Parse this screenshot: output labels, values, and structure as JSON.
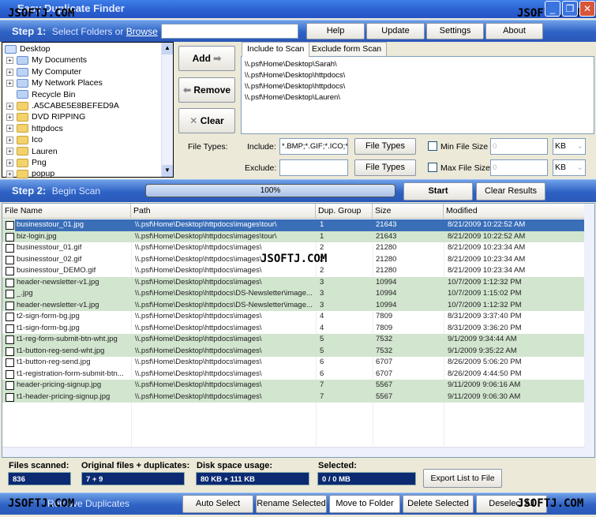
{
  "app": {
    "title": "Easy Duplicate Finder",
    "watermark": "JSOFTJ.COM"
  },
  "window_controls": {
    "minimize": "_",
    "maximize": "❐",
    "close": "✕"
  },
  "step1": {
    "step": "Step 1:",
    "text": "Select Folders or",
    "link": "Browse",
    "input_value": "",
    "buttons": [
      "Help",
      "Update",
      "Settings",
      "About"
    ]
  },
  "tree": {
    "root": "Desktop",
    "items": [
      "My Documents",
      "My Computer",
      "My Network Places",
      "Recycle Bin",
      ".A5CABE5E8BEFED9A",
      "DVD RIPPING",
      "httpdocs",
      "Ico",
      "Lauren",
      "Png",
      "popup"
    ]
  },
  "actions": {
    "add": "Add",
    "remove": "Remove",
    "clear": "Clear"
  },
  "scan_tabs": [
    "Include to Scan",
    "Exclude form Scan"
  ],
  "scan_paths": [
    "\\\\.psf\\Home\\Desktop\\Sarah\\",
    "\\\\.psf\\Home\\Desktop\\httpdocs\\",
    "\\\\.psf\\Home\\Desktop\\httpdocs\\",
    "\\\\.psf\\Home\\Desktop\\Lauren\\"
  ],
  "filters": {
    "file_types_label": "File Types:",
    "include_label": "Include:",
    "include_value": "*.BMP;*.GIF;*.ICO;*.",
    "exclude_label": "Exclude:",
    "exclude_value": "",
    "file_types_btn": "File Types",
    "min_label": "Min File Size",
    "max_label": "Max File Size",
    "min_value": "0",
    "max_value": "0",
    "unit": "KB",
    "min_checked": false,
    "max_checked": false
  },
  "step2": {
    "step": "Step 2:",
    "text": "Begin Scan",
    "progress_text": "100%",
    "progress": 100,
    "start": "Start",
    "clear_results": "Clear Results"
  },
  "table": {
    "columns": [
      "File Name",
      "Path",
      "Dup. Group",
      "Size",
      "Modified"
    ],
    "sort_indicator": "▲",
    "rows": [
      [
        "businesstour_01.jpg",
        "\\\\.psf\\Home\\Desktop\\httpdocs\\images\\tour\\",
        "1",
        "21643",
        "8/21/2009 10:22:52 AM"
      ],
      [
        "biz-login.jpg",
        "\\\\.psf\\Home\\Desktop\\httpdocs\\images\\tour\\",
        "1",
        "21643",
        "8/21/2009 10:22:52 AM"
      ],
      [
        "businesstour_01.gif",
        "\\\\.psf\\Home\\Desktop\\httpdocs\\images\\",
        "2",
        "21280",
        "8/21/2009 10:23:34 AM"
      ],
      [
        "businesstour_02.gif",
        "\\\\.psf\\Home\\Desktop\\httpdocs\\images\\",
        "2",
        "21280",
        "8/21/2009 10:23:34 AM"
      ],
      [
        "businesstour_DEMO.gif",
        "\\\\.psf\\Home\\Desktop\\httpdocs\\images\\",
        "2",
        "21280",
        "8/21/2009 10:23:34 AM"
      ],
      [
        "header-newsletter-v1.jpg",
        "\\\\.psf\\Home\\Desktop\\httpdocs\\images\\",
        "3",
        "10994",
        "10/7/2009 1:12:32 PM"
      ],
      [
        "_.jpg",
        "\\\\.psf\\Home\\Desktop\\httpdocs\\DS-Newsletter\\image...",
        "3",
        "10994",
        "10/7/2009 1:15:02 PM"
      ],
      [
        "header-newsletter-v1.jpg",
        "\\\\.psf\\Home\\Desktop\\httpdocs\\DS-Newsletter\\image...",
        "3",
        "10994",
        "10/7/2009 1:12:32 PM"
      ],
      [
        "t2-sign-form-bg.jpg",
        "\\\\.psf\\Home\\Desktop\\httpdocs\\images\\",
        "4",
        "7809",
        "8/31/2009 3:37:40 PM"
      ],
      [
        "t1-sign-form-bg.jpg",
        "\\\\.psf\\Home\\Desktop\\httpdocs\\images\\",
        "4",
        "7809",
        "8/31/2009 3:36:20 PM"
      ],
      [
        "t1-reg-form-submit-btn-wht.jpg",
        "\\\\.psf\\Home\\Desktop\\httpdocs\\images\\",
        "5",
        "7532",
        "9/1/2009 9:34:44 AM"
      ],
      [
        "t1-button-reg-send-wht.jpg",
        "\\\\.psf\\Home\\Desktop\\httpdocs\\images\\",
        "5",
        "7532",
        "9/1/2009 9:35:22 AM"
      ],
      [
        "t1-button-reg-send.jpg",
        "\\\\.psf\\Home\\Desktop\\httpdocs\\images\\",
        "6",
        "6707",
        "8/26/2009 5:06:20 PM"
      ],
      [
        "t1-registration-form-submit-btn...",
        "\\\\.psf\\Home\\Desktop\\httpdocs\\images\\",
        "6",
        "6707",
        "8/26/2009 4:44:50 PM"
      ],
      [
        "header-pricing-signup.jpg",
        "\\\\.psf\\Home\\Desktop\\httpdocs\\images\\",
        "7",
        "5567",
        "9/11/2009 9:06:16 AM"
      ],
      [
        "t1-header-pricing-signup.jpg",
        "\\\\.psf\\Home\\Desktop\\httpdocs\\images\\",
        "7",
        "5567",
        "9/11/2009 9:06:30 AM"
      ]
    ],
    "selected_row": 0
  },
  "status": {
    "files_scanned_label": "Files scanned:",
    "files_scanned": "836",
    "orig_label": "Original files + duplicates:",
    "orig": "7 + 9",
    "disk_label": "Disk space usage:",
    "disk": "80 KB + 111 KB",
    "selected_label": "Selected:",
    "selected": "0 / 0 MB",
    "export": "Export List to File"
  },
  "step3": {
    "text": "Remove Duplicates",
    "buttons": [
      "Auto Select",
      "Rename Selected",
      "Move to Folder",
      "Delete Selected",
      "Deselect All"
    ]
  },
  "colors": {
    "bar_blue": "#2e62c4",
    "row_green": "#d2e5cf",
    "selection": "#3a6fb8",
    "status_bg": "#0b2a72"
  }
}
